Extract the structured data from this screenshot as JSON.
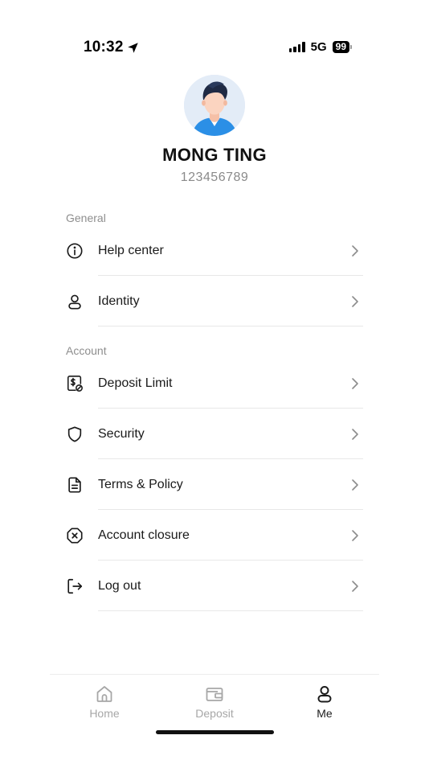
{
  "status_bar": {
    "time": "10:32",
    "network": "5G",
    "battery": "99"
  },
  "profile": {
    "name": "MONG TING",
    "id": "123456789"
  },
  "sections": {
    "general": {
      "label": "General",
      "items": [
        {
          "label": "Help center",
          "icon": "info-circle-icon"
        },
        {
          "label": "Identity",
          "icon": "user-icon"
        }
      ]
    },
    "account": {
      "label": "Account",
      "items": [
        {
          "label": "Deposit Limit",
          "icon": "dollar-doc-limit-icon"
        },
        {
          "label": "Security",
          "icon": "shield-icon"
        },
        {
          "label": "Terms & Policy",
          "icon": "document-icon"
        },
        {
          "label": "Account closure",
          "icon": "close-octagon-icon"
        },
        {
          "label": "Log out",
          "icon": "logout-icon"
        }
      ]
    }
  },
  "tabbar": {
    "tabs": [
      {
        "label": "Home",
        "icon": "home-icon",
        "active": false
      },
      {
        "label": "Deposit",
        "icon": "wallet-icon",
        "active": false
      },
      {
        "label": "Me",
        "icon": "user-icon",
        "active": true
      }
    ]
  },
  "colors": {
    "text": "#1a1a1a",
    "muted": "#8e8e8e",
    "divider": "#e8e8e8",
    "avatar_bg": "#e3ecf7",
    "shirt": "#2b8fe6"
  }
}
